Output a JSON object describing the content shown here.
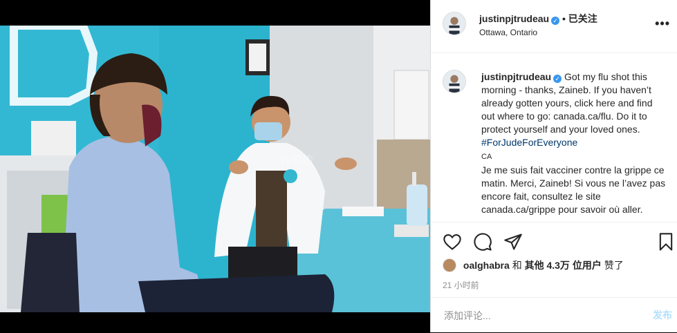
{
  "post": {
    "username": "justinpjtrudeau",
    "follow_status": "• 已关注",
    "location": "Ottawa, Ontario",
    "more_icon": "more-options-icon",
    "verified_icon": "verified-badge-icon"
  },
  "caption": {
    "username": "justinpjtrudeau",
    "text_en": "Got my flu shot this morning - thanks, Zaineb. If you haven’t already gotten yours, click here and find out where to go: canada.ca/flu. Do it to protect yourself and your loved ones.",
    "hashtag": "#ForJudeForEveryone",
    "lang_tag": "CA",
    "text_fr": "Je me suis fait vacciner contre la grippe ce matin. Merci, Zaineb! Si vous ne l’avez pas encore fait, consultez le site canada.ca/grippe pour savoir où aller."
  },
  "actions": {
    "like_icon": "heart-icon",
    "comment_icon": "comment-icon",
    "share_icon": "share-icon",
    "save_icon": "bookmark-icon"
  },
  "likes": {
    "user": "oalghabra",
    "and": "和",
    "others": "其他 4.3万 位用户",
    "liked": "赞了"
  },
  "timestamp": "21 小时前",
  "comment": {
    "placeholder": "添加评论...",
    "post_label": "发布"
  },
  "colors": {
    "link": "#00376b",
    "verified": "#3897f0",
    "post_button": "#b2dffc",
    "muted": "#8e8e8e"
  }
}
